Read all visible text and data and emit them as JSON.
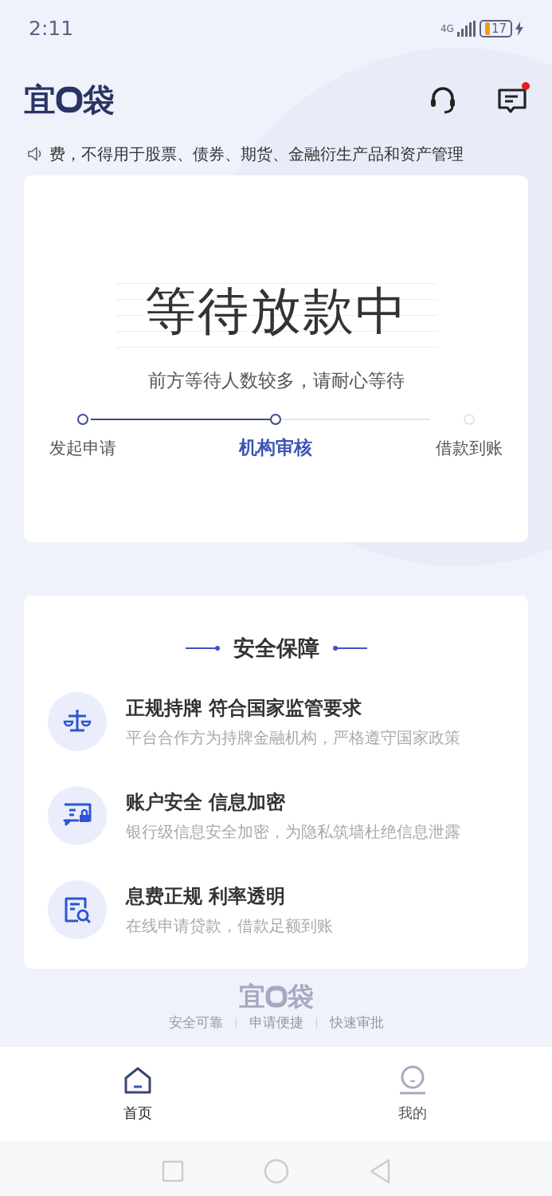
{
  "status_bar": {
    "time": "2:11",
    "network": "4G",
    "battery": "17"
  },
  "header": {
    "logo": {
      "left": "宜",
      "right": "袋"
    },
    "notification_dot": true
  },
  "notice": {
    "text": "费，不得用于股票、债券、期货、金融衍生产品和资产管理"
  },
  "status_card": {
    "title": "等待放款中",
    "subtitle": "前方等待人数较多，请耐心等待",
    "steps": [
      {
        "label": "发起申请",
        "done": true,
        "selected": false
      },
      {
        "label": "机构审核",
        "done": true,
        "selected": true
      },
      {
        "label": "借款到账",
        "done": false,
        "selected": false
      }
    ]
  },
  "security": {
    "title": "安全保障",
    "items": [
      {
        "kind": "scale",
        "title": "正规持牌 符合国家监管要求",
        "desc": "平台合作方为持牌金融机构，严格遵守国家政策"
      },
      {
        "kind": "chat-lock",
        "title": "账户安全 信息加密",
        "desc": "银行级信息安全加密，为隐私筑墙杜绝信息泄露"
      },
      {
        "kind": "doc-search",
        "title": "息费正规  利率透明",
        "desc": "在线申请贷款，借款足额到账"
      }
    ]
  },
  "footer": {
    "logo": {
      "left": "宜",
      "right": "袋"
    },
    "slogans": [
      "安全可靠",
      "申请便捷",
      "快速审批"
    ]
  },
  "tab_bar": [
    {
      "kind": "home",
      "label": "首页",
      "selected": true
    },
    {
      "kind": "me",
      "label": "我的",
      "selected": false
    }
  ]
}
